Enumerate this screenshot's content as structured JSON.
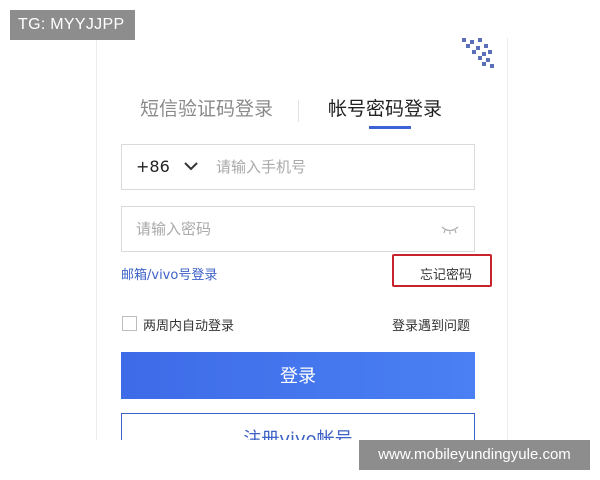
{
  "watermarks": {
    "top_left": "TG: MYYJJPP",
    "bottom_right": "www.mobileyundingyule.com"
  },
  "tabs": {
    "sms_login": "短信验证码登录",
    "password_login": "帐号密码登录",
    "active": "password_login"
  },
  "phone": {
    "country_code": "+86",
    "placeholder": "请输入手机号",
    "value": ""
  },
  "password": {
    "placeholder": "请输入密码",
    "value": ""
  },
  "links": {
    "email_login": "邮箱/vivo号登录",
    "forgot_password": "忘记密码",
    "login_trouble": "登录遇到问题"
  },
  "remember": {
    "label": "两周内自动登录",
    "checked": false
  },
  "buttons": {
    "login": "登录",
    "register": "注册vivo帐号"
  },
  "colors": {
    "accent": "#3c63d6",
    "login_button": "#4476ee",
    "highlight": "#c8232c"
  },
  "icons": {
    "country_dropdown": "chevron-down-icon",
    "password_visibility": "eye-closed-icon",
    "qr_code": "qr-code-icon"
  }
}
